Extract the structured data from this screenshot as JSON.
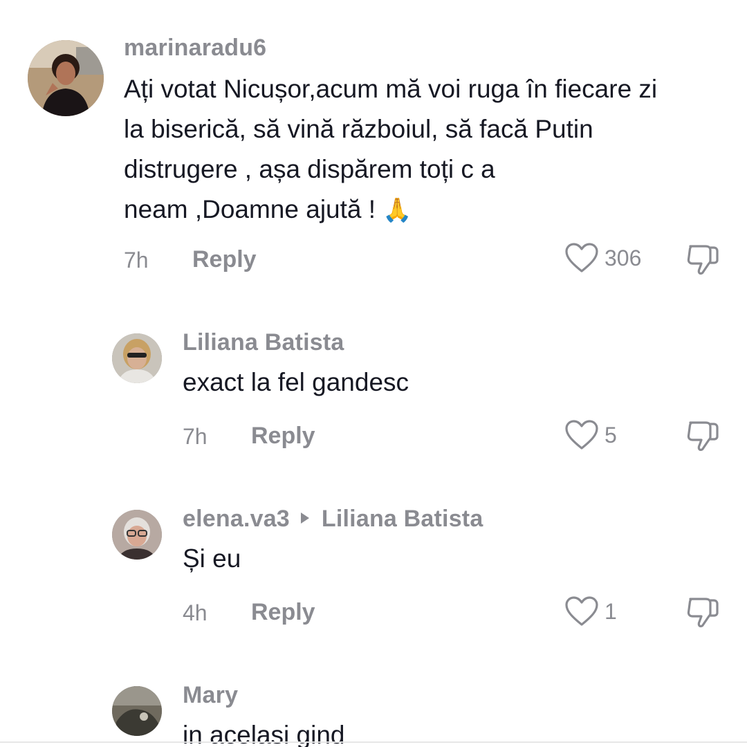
{
  "comments": [
    {
      "username": "marinaradu6",
      "text_lines": [
        "Ați votat Nicușor,acum mă voi ruga în fiecare zi",
        "la biserică, să vină războiul, să facă Putin",
        "distrugere , așa dispărem toți c a",
        "neam ,Doamne ajută ! "
      ],
      "emoji": "🙏",
      "time": "7h",
      "reply_label": "Reply",
      "likes": "306",
      "avatar_icon": "user-avatar"
    },
    {
      "username": "Liliana Batista",
      "text": "exact la fel gandesc",
      "time": "7h",
      "reply_label": "Reply",
      "likes": "5",
      "avatar_icon": "user-avatar"
    },
    {
      "username": "elena.va3",
      "reply_to": "Liliana Batista",
      "text": "Și eu",
      "time": "4h",
      "reply_label": "Reply",
      "likes": "1",
      "avatar_icon": "user-avatar"
    },
    {
      "username": "Mary",
      "text": "in acelasi gind",
      "avatar_icon": "user-avatar"
    }
  ],
  "colors": {
    "muted": "#8a8b91",
    "text": "#161823",
    "background": "#ffffff"
  }
}
